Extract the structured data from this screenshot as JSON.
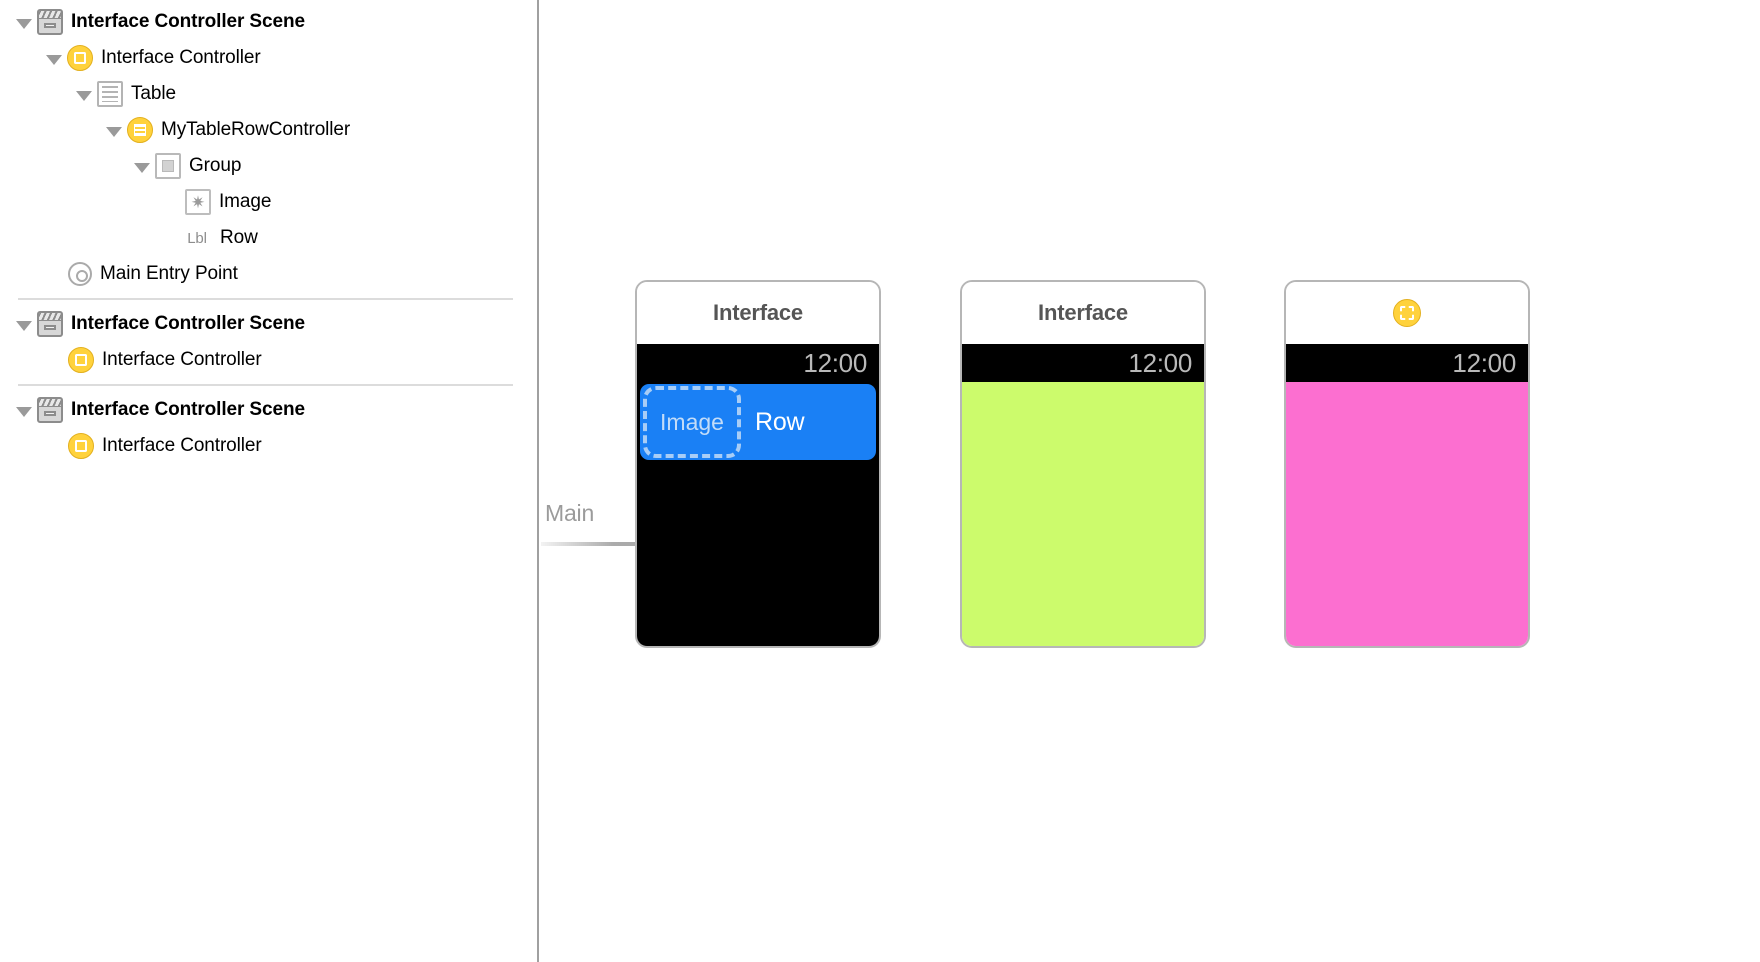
{
  "outline": {
    "scenes": [
      {
        "name": "scene-1",
        "rows": [
          {
            "label": "Interface Controller Scene",
            "icon": "scene-icon",
            "indent": 0,
            "disclosure": "open",
            "bold": true
          },
          {
            "label": "Interface Controller",
            "icon": "interface-controller-icon",
            "indent": 1,
            "disclosure": "open",
            "bold": false
          },
          {
            "label": "Table",
            "icon": "table-icon",
            "indent": 2,
            "disclosure": "open",
            "bold": false
          },
          {
            "label": "MyTableRowController",
            "icon": "row-controller-icon",
            "indent": 3,
            "disclosure": "open",
            "bold": false
          },
          {
            "label": "Group",
            "icon": "group-icon",
            "indent": 4,
            "disclosure": "open",
            "bold": false
          },
          {
            "label": "Image",
            "icon": "image-icon",
            "indent": 5,
            "disclosure": "none",
            "bold": false
          },
          {
            "label": "Row",
            "icon": "label-badge-icon",
            "badge": "Lbl",
            "indent": 5,
            "disclosure": "none",
            "bold": false
          },
          {
            "label": "Main Entry Point",
            "icon": "main-entry-point-icon",
            "indent": 1,
            "disclosure": "none",
            "bold": false
          }
        ]
      },
      {
        "name": "scene-2",
        "rows": [
          {
            "label": "Interface Controller Scene",
            "icon": "scene-icon",
            "indent": 0,
            "disclosure": "open",
            "bold": true
          },
          {
            "label": "Interface Controller",
            "icon": "interface-controller-icon",
            "indent": 1,
            "disclosure": "none",
            "bold": false
          }
        ]
      },
      {
        "name": "scene-3",
        "rows": [
          {
            "label": "Interface Controller Scene",
            "icon": "scene-icon",
            "indent": 0,
            "disclosure": "open",
            "bold": true
          },
          {
            "label": "Interface Controller",
            "icon": "interface-controller-icon",
            "indent": 1,
            "disclosure": "none",
            "bold": false
          }
        ]
      }
    ]
  },
  "canvas": {
    "entry_arrow_label": "Main",
    "devices": [
      {
        "name": "device-1",
        "title": "Interface",
        "has_title": true,
        "has_icon_title": false,
        "time": "12:00",
        "screen_color": "#000000",
        "row": {
          "image_placeholder_label": "Image",
          "row_label": "Row",
          "row_color": "#1a80f5"
        }
      },
      {
        "name": "device-2",
        "title": "Interface",
        "has_title": true,
        "has_icon_title": false,
        "time": "12:00",
        "screen_color": "#ccfb6c"
      },
      {
        "name": "device-3",
        "title": "",
        "has_title": false,
        "has_icon_title": true,
        "time": "12:00",
        "screen_color": "#fc6fd0"
      }
    ]
  },
  "colors": {
    "accent_yellow": "#ffd23c",
    "selection_blue": "#1a80f5",
    "green_screen": "#ccfb6c",
    "pink_screen": "#fc6fd0",
    "divider_gray": "#dcdcdc"
  }
}
